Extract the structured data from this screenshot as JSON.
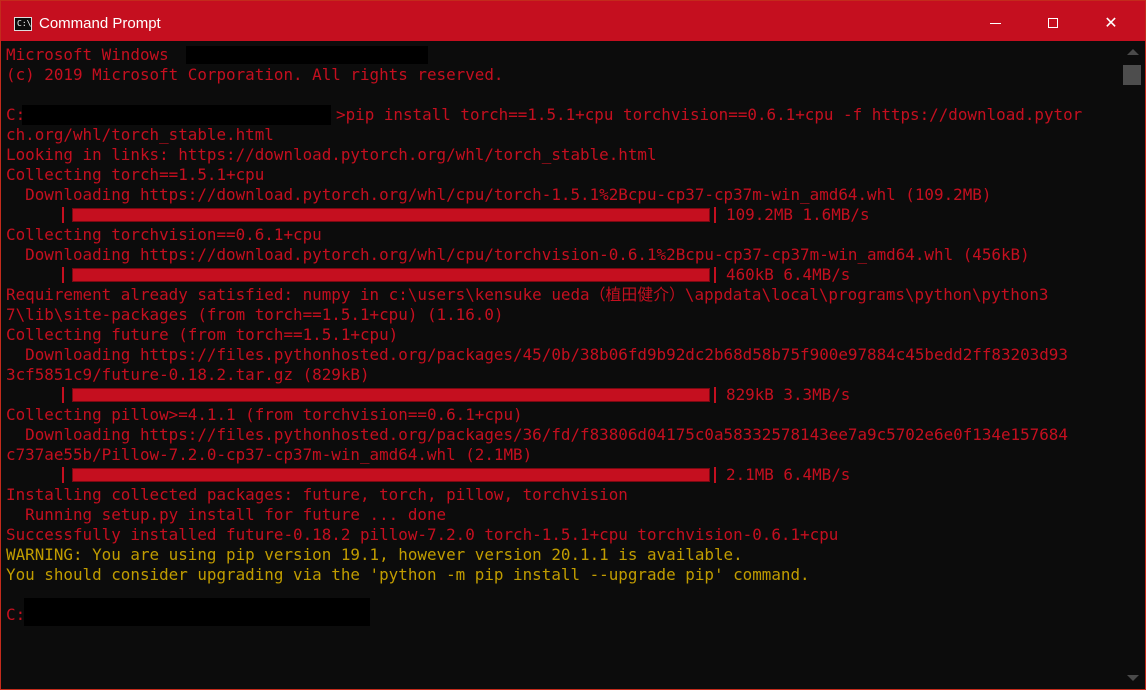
{
  "window": {
    "title": "Command Prompt",
    "icon": "cmd-icon",
    "icon_text": "C:\\",
    "controls": {
      "minimize": "minimize-icon",
      "maximize": "maximize-icon",
      "close": "close-icon",
      "close_glyph": "✕"
    }
  },
  "colors": {
    "titlebar": "#c50f1f",
    "text": "#c50f1f",
    "warning": "#c19c00",
    "background": "#0c0c0c"
  },
  "console": {
    "l1": "Microsoft Windows",
    "l2": "(c) 2019 Microsoft Corporation. All rights reserved.",
    "l3_prefix": "C:",
    "l3_cmd": ">pip install torch==1.5.1+cpu torchvision==0.6.1+cpu -f https://download.pytor",
    "l4": "ch.org/whl/torch_stable.html",
    "l5": "Looking in links: https://download.pytorch.org/whl/torch_stable.html",
    "l6": "Collecting torch==1.5.1+cpu",
    "l7": "  Downloading https://download.pytorch.org/whl/cpu/torch-1.5.1%2Bcpu-cp37-cp37m-win_amd64.whl (109.2MB)",
    "p1_stats": "109.2MB 1.6MB/s",
    "l9": "Collecting torchvision==0.6.1+cpu",
    "l10": "  Downloading https://download.pytorch.org/whl/cpu/torchvision-0.6.1%2Bcpu-cp37-cp37m-win_amd64.whl (456kB)",
    "p2_stats": "460kB 6.4MB/s",
    "l12": "Requirement already satisfied: numpy in c:\\users\\kensuke ueda（植田健介）\\appdata\\local\\programs\\python\\python3",
    "l13": "7\\lib\\site-packages (from torch==1.5.1+cpu) (1.16.0)",
    "l14": "Collecting future (from torch==1.5.1+cpu)",
    "l15": "  Downloading https://files.pythonhosted.org/packages/45/0b/38b06fd9b92dc2b68d58b75f900e97884c45bedd2ff83203d93",
    "l16": "3cf5851c9/future-0.18.2.tar.gz (829kB)",
    "p3_stats": "829kB 3.3MB/s",
    "l18": "Collecting pillow>=4.1.1 (from torchvision==0.6.1+cpu)",
    "l19": "  Downloading https://files.pythonhosted.org/packages/36/fd/f83806d04175c0a58332578143ee7a9c5702e6e0f134e157684",
    "l20": "c737ae55b/Pillow-7.2.0-cp37-cp37m-win_amd64.whl (2.1MB)",
    "p4_stats": "2.1MB 6.4MB/s",
    "l22": "Installing collected packages: future, torch, pillow, torchvision",
    "l23": "  Running setup.py install for future ... done",
    "l24": "Successfully installed future-0.18.2 pillow-7.2.0 torch-1.5.1+cpu torchvision-0.6.1+cpu",
    "l25": "WARNING: You are using pip version 19.1, however version 20.1.1 is available.",
    "l26": "You should consider upgrading via the 'python -m pip install --upgrade pip' command.",
    "l28_prefix": "C:"
  },
  "progress": {
    "torch": 1.0,
    "torchvision": 1.0,
    "future": 1.0,
    "pillow": 1.0
  }
}
